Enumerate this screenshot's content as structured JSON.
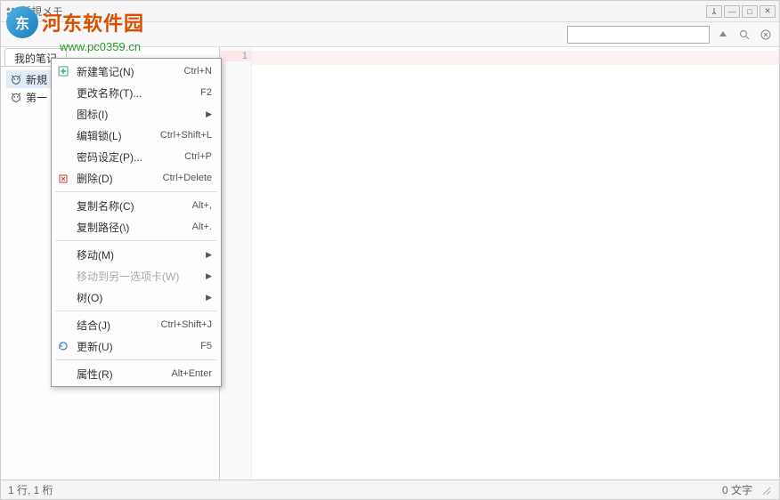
{
  "window": {
    "title": "新規メモ"
  },
  "watermark": {
    "brand": "河东软件园",
    "url": "www.pc0359.cn"
  },
  "sidebar": {
    "tab_label": "我的笔记",
    "items": [
      {
        "label": "新規",
        "selected": true
      },
      {
        "label": "第一",
        "selected": false
      }
    ]
  },
  "editor": {
    "line_numbers": [
      "1"
    ]
  },
  "context_menu": [
    {
      "type": "item",
      "icon": "add",
      "label": "新建笔记(N)",
      "shortcut": "Ctrl+N"
    },
    {
      "type": "item",
      "label": "更改名称(T)...",
      "shortcut": "F2"
    },
    {
      "type": "item",
      "label": "图标(I)",
      "submenu": true
    },
    {
      "type": "item",
      "label": "编辑锁(L)",
      "shortcut": "Ctrl+Shift+L"
    },
    {
      "type": "item",
      "label": "密码设定(P)...",
      "shortcut": "Ctrl+P"
    },
    {
      "type": "item",
      "icon": "delete",
      "label": "删除(D)",
      "shortcut": "Ctrl+Delete"
    },
    {
      "type": "sep"
    },
    {
      "type": "item",
      "label": "复制名称(C)",
      "shortcut": "Alt+,"
    },
    {
      "type": "item",
      "label": "复制路径(\\)",
      "shortcut": "Alt+."
    },
    {
      "type": "sep"
    },
    {
      "type": "item",
      "label": "移动(M)",
      "submenu": true
    },
    {
      "type": "item",
      "label": "移动到另一选项卡(W)",
      "submenu": true,
      "disabled": true
    },
    {
      "type": "item",
      "label": "树(O)",
      "submenu": true
    },
    {
      "type": "sep"
    },
    {
      "type": "item",
      "label": "结合(J)",
      "shortcut": "Ctrl+Shift+J"
    },
    {
      "type": "item",
      "icon": "refresh",
      "label": "更新(U)",
      "shortcut": "F5"
    },
    {
      "type": "sep"
    },
    {
      "type": "item",
      "label": "属性(R)",
      "shortcut": "Alt+Enter"
    }
  ],
  "status": {
    "left": "1 行, 1 桁",
    "right": "0 文字"
  }
}
